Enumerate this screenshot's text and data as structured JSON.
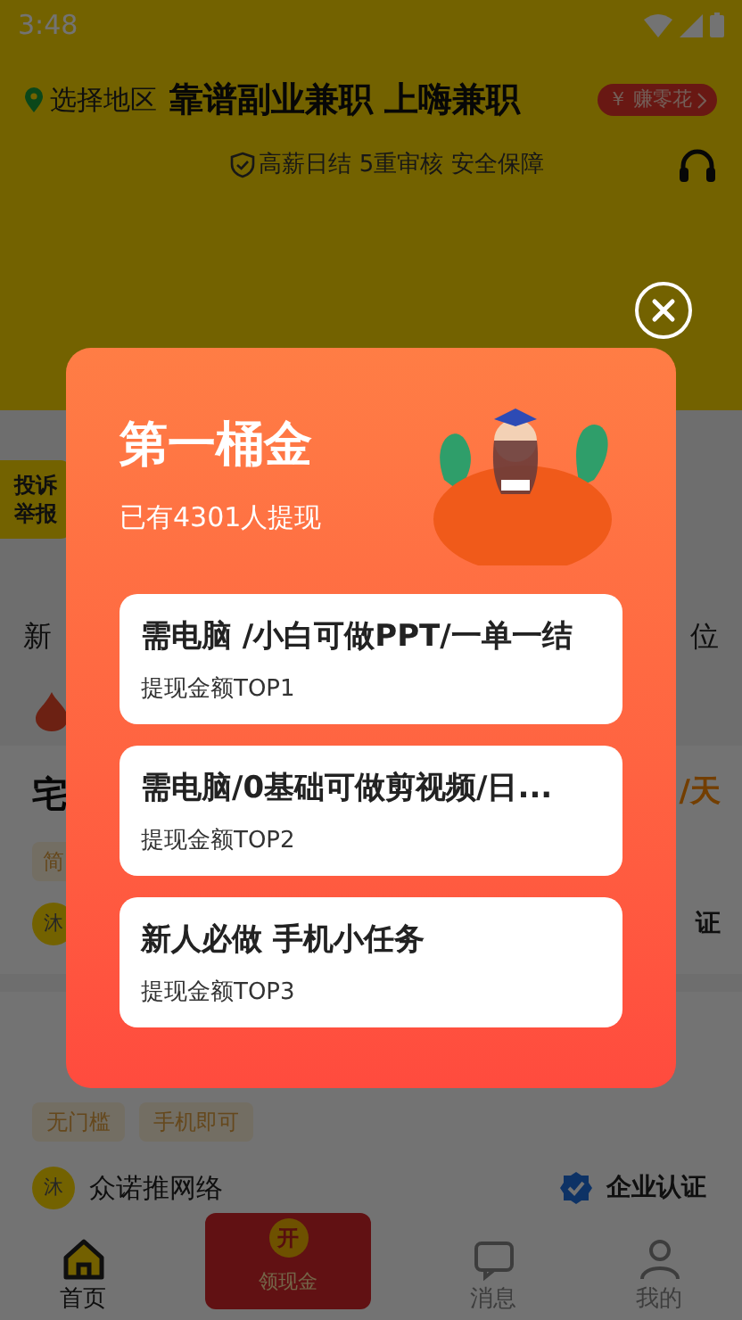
{
  "status_bar": {
    "time": "3:48"
  },
  "header": {
    "location": "选择地区",
    "title": "靠谱副业兼职 上嗨兼职",
    "promo": "赚零花",
    "promo_glyph": "￥",
    "guarantee": "高薪日结 5重审核 安全保障"
  },
  "side_tab": {
    "lines": [
      "投诉",
      "举报"
    ]
  },
  "categories": [
    {
      "label": "新"
    },
    {
      "label": "位"
    }
  ],
  "jobs": [
    {
      "title": "宅",
      "pay": "/天",
      "tags": [
        "简"
      ],
      "avatar": "沐",
      "verified": "证"
    },
    {
      "tags": [
        "无门槛",
        "手机即可"
      ],
      "avatar": "沐",
      "company": "众诺推网络",
      "verified": "企业认证"
    }
  ],
  "bottom_nav": [
    {
      "kind": "tab",
      "label": "首页",
      "selected": true
    },
    {
      "kind": "promo",
      "label": "领现金",
      "badge": "开",
      "selected": false
    },
    {
      "kind": "tab",
      "label": "消息",
      "selected": false
    },
    {
      "kind": "tab",
      "label": "我的",
      "selected": false
    }
  ],
  "modal": {
    "title": "第一桶金",
    "subtitle": "已有4301人提现",
    "items": [
      {
        "title": "需电脑 /小白可做PPT/一单一结",
        "rank": "提现金额TOP1"
      },
      {
        "title": "需电脑/0基础可做剪视频/日...",
        "rank": "提现金额TOP2"
      },
      {
        "title": "新人必做 手机小任务",
        "rank": "提现金额TOP3"
      }
    ]
  }
}
